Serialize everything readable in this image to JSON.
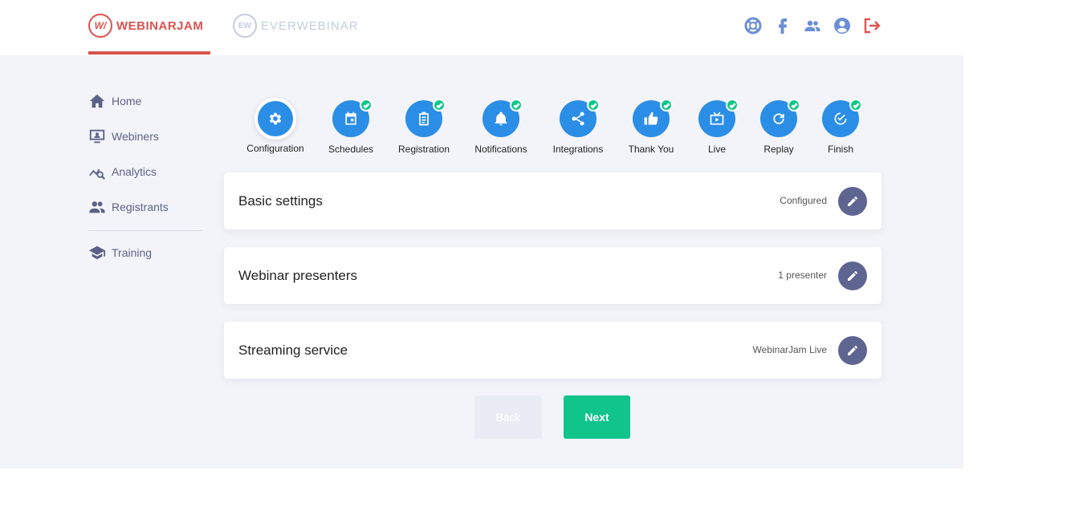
{
  "header": {
    "brand_primary": {
      "mark": "W/",
      "name": "WEBINARJAM"
    },
    "brand_secondary": {
      "mark": "EW",
      "name": "EVERWEBINAR"
    },
    "icons": [
      "support-icon",
      "facebook-icon",
      "community-icon",
      "account-icon",
      "logout-icon"
    ]
  },
  "sidebar": {
    "items": [
      {
        "label": "Home",
        "icon": "home-icon"
      },
      {
        "label": "Webiners",
        "icon": "webinars-icon"
      },
      {
        "label": "Analytics",
        "icon": "analytics-icon"
      },
      {
        "label": "Registrants",
        "icon": "registrants-icon"
      }
    ],
    "training": {
      "label": "Training",
      "icon": "training-icon"
    }
  },
  "steps": [
    {
      "label": "Configuration",
      "icon": "gear-icon",
      "active": true,
      "done": false
    },
    {
      "label": "Schedules",
      "icon": "calendar-icon",
      "active": false,
      "done": true
    },
    {
      "label": "Registration",
      "icon": "clipboard-icon",
      "active": false,
      "done": true
    },
    {
      "label": "Notifications",
      "icon": "bell-icon",
      "active": false,
      "done": true
    },
    {
      "label": "Integrations",
      "icon": "share-icon",
      "active": false,
      "done": true
    },
    {
      "label": "Thank You",
      "icon": "thumbs-up-icon",
      "active": false,
      "done": true
    },
    {
      "label": "Live",
      "icon": "tv-icon",
      "active": false,
      "done": true
    },
    {
      "label": "Replay",
      "icon": "replay-icon",
      "active": false,
      "done": true
    },
    {
      "label": "Finish",
      "icon": "check-circle-icon",
      "active": false,
      "done": true
    }
  ],
  "cards": [
    {
      "title": "Basic settings",
      "status": "Configured"
    },
    {
      "title": "Webinar presenters",
      "status": "1 presenter"
    },
    {
      "title": "Streaming service",
      "status": "WebinarJam Live"
    }
  ],
  "actions": {
    "back_label": "Back",
    "next_label": "Next"
  },
  "colors": {
    "brand_red": "#d9534f",
    "step_blue": "#2b8ee6",
    "done_green": "#10c68a",
    "next_green": "#11c48a",
    "edit_purple": "#5f6591",
    "sidebar_text": "#5b6288",
    "page_bg": "#f3f4f9"
  }
}
